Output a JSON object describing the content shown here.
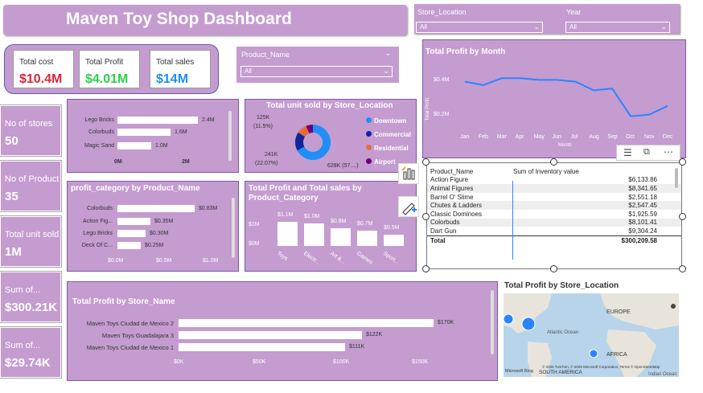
{
  "header": {
    "title": "Maven Toy Shop Dashboard"
  },
  "slicers": {
    "store_location": {
      "label": "Store_Location",
      "value": "All"
    },
    "year": {
      "label": "Year",
      "value": "All"
    },
    "product_name": {
      "label": "Product_Name",
      "value": "All"
    }
  },
  "kpis": [
    {
      "label": "Total cost",
      "value": "$10.4M",
      "color": "#d9263a"
    },
    {
      "label": "Total Profit",
      "value": "$4.01M",
      "color": "#2bd14a"
    },
    {
      "label": "Total sales",
      "value": "$14M",
      "color": "#1f8ef5"
    }
  ],
  "side_cards": [
    {
      "label": "No of stores",
      "value": "50"
    },
    {
      "label": "No of Product",
      "value": "35"
    },
    {
      "label": "Total unit sold",
      "value": "1M"
    },
    {
      "label": "Sum of...",
      "value": "$300.21K"
    },
    {
      "label": "Sum of...",
      "value": "$29.74K"
    }
  ],
  "units_by_product": {
    "items": [
      {
        "label": "Lego Bricks",
        "value": "2.4M"
      },
      {
        "label": "Colorbuds",
        "value": "1.6M"
      },
      {
        "label": "Magic Sand",
        "value": "1.0M"
      }
    ],
    "ticks": [
      "0M",
      "2M"
    ]
  },
  "profit_category": {
    "title": "profit_category by Product_Name",
    "items": [
      {
        "label": "Colorbuds",
        "value": "$0.83M"
      },
      {
        "label": "Action Fig...",
        "value": "$0.35M"
      },
      {
        "label": "Lego Bricks",
        "value": "$0.30M"
      },
      {
        "label": "Deck Of C...",
        "value": "$0.25M"
      }
    ],
    "ticks": [
      "$0.0M",
      "$0.5M",
      "$1.0M"
    ]
  },
  "donut": {
    "title": "Total unit sold by Store_Location",
    "labels": {
      "top": "125K",
      "top_pct": "(11.5%)",
      "left": "241K",
      "left_pct": "(22.07%)",
      "right": "628K (57....)"
    },
    "legend": [
      {
        "label": "Downtown",
        "color": "#1f8ef5"
      },
      {
        "label": "Commercial",
        "color": "#12239e"
      },
      {
        "label": "Residential",
        "color": "#e66c37"
      },
      {
        "label": "Airport",
        "color": "#6b007b"
      }
    ]
  },
  "profit_sales_category": {
    "title": "Total Profit and Total sales by Product_Category",
    "y_ticks": [
      "$1M",
      "$0M"
    ],
    "bars": [
      {
        "label": "Toys",
        "value": "$1.1M"
      },
      {
        "label": "Electr...",
        "value": "$1.0M"
      },
      {
        "label": "Art &...",
        "value": "$0.8M"
      },
      {
        "label": "Games",
        "value": "$0.7M"
      },
      {
        "label": "Sport...",
        "value": "$0.5M"
      }
    ]
  },
  "profit_month": {
    "title": "Total Profit by Month",
    "y_axis": "Total Profit",
    "x_axis": "Month",
    "y_ticks": [
      "$0.4M",
      "$0.2M"
    ],
    "months": [
      "Jan",
      "Feb",
      "Mar",
      "Apr",
      "May",
      "Jun",
      "Jul",
      "Aug",
      "Sep",
      "Oct",
      "Nov",
      "Dec"
    ]
  },
  "inventory_table": {
    "headers": [
      "Product_Name",
      "Sum of Inventory value"
    ],
    "rows": [
      [
        "Action Figure",
        "$6,133.86"
      ],
      [
        "Animal Figures",
        "$8,341.65"
      ],
      [
        "Barrel O' Slime",
        "$2,551.18"
      ],
      [
        "Chutes & Ladders",
        "$2,547.45"
      ],
      [
        "Classic Dominoes",
        "$1,925.59"
      ],
      [
        "Colorbuds",
        "$8,101.41"
      ],
      [
        "Dart Gun",
        "$9,304.24"
      ]
    ],
    "total_label": "Total",
    "total_value": "$300,209.58"
  },
  "store_name_chart": {
    "title": "Total Profit by Store_Name",
    "items": [
      {
        "label": "Maven Toys Ciudad de Mexico 2",
        "value": "$170K"
      },
      {
        "label": "Maven Toys Guadalajara 3",
        "value": "$122K"
      },
      {
        "label": "Maven Toys Ciudad de Mexico 1",
        "value": "$111K"
      }
    ],
    "ticks": [
      "$0K",
      "$50K",
      "$100K",
      "$150K"
    ]
  },
  "map": {
    "title": "Total Profit by Store_Location",
    "labels": {
      "europe": "EUROPE",
      "atlantic": "Atlantic Ocean",
      "africa": "AFRICA",
      "south_america": "SOUTH AMERICA",
      "indian": "Indian Ocean"
    },
    "credits": "© 2025 TomTom, © 2025 Microsoft Corporation, Terms © OpenStreetMap",
    "brand": "Microsoft Bing"
  },
  "chart_data": [
    {
      "type": "bar",
      "title": "",
      "categories": [
        "Lego Bricks",
        "Colorbuds",
        "Magic Sand"
      ],
      "values": [
        2.4,
        1.6,
        1.0
      ],
      "xlim": [
        0,
        2.6
      ]
    },
    {
      "type": "bar",
      "title": "profit_category by Product_Name",
      "categories": [
        "Colorbuds",
        "Action Fig...",
        "Lego Bricks",
        "Deck Of C..."
      ],
      "values": [
        0.83,
        0.35,
        0.3,
        0.25
      ],
      "xlim": [
        0,
        1.0
      ]
    },
    {
      "type": "pie",
      "title": "Total unit sold by Store_Location",
      "categories": [
        "Downtown",
        "Commercial",
        "Residential",
        "Airport"
      ],
      "values": [
        628,
        241,
        125,
        97
      ]
    },
    {
      "type": "bar",
      "title": "Total Profit and Total sales by Product_Category",
      "categories": [
        "Toys",
        "Electr...",
        "Art &...",
        "Games",
        "Sport..."
      ],
      "values": [
        1.1,
        1.0,
        0.8,
        0.7,
        0.5
      ],
      "ylim": [
        0,
        1.3
      ]
    },
    {
      "type": "line",
      "title": "Total Profit by Month",
      "x": [
        "Jan",
        "Feb",
        "Mar",
        "Apr",
        "May",
        "Jun",
        "Jul",
        "Aug",
        "Sep",
        "Oct",
        "Nov",
        "Dec"
      ],
      "values": [
        0.38,
        0.36,
        0.4,
        0.4,
        0.39,
        0.39,
        0.38,
        0.33,
        0.34,
        0.18,
        0.19,
        0.24
      ],
      "ylim": [
        0.1,
        0.48
      ],
      "xlabel": "Month",
      "ylabel": "Total Profit"
    },
    {
      "type": "bar",
      "title": "Total Profit by Store_Name",
      "categories": [
        "Maven Toys Ciudad de Mexico 2",
        "Maven Toys Guadalajara 3",
        "Maven Toys Ciudad de Mexico 1"
      ],
      "values": [
        170,
        122,
        111
      ],
      "xlim": [
        0,
        180
      ]
    }
  ]
}
